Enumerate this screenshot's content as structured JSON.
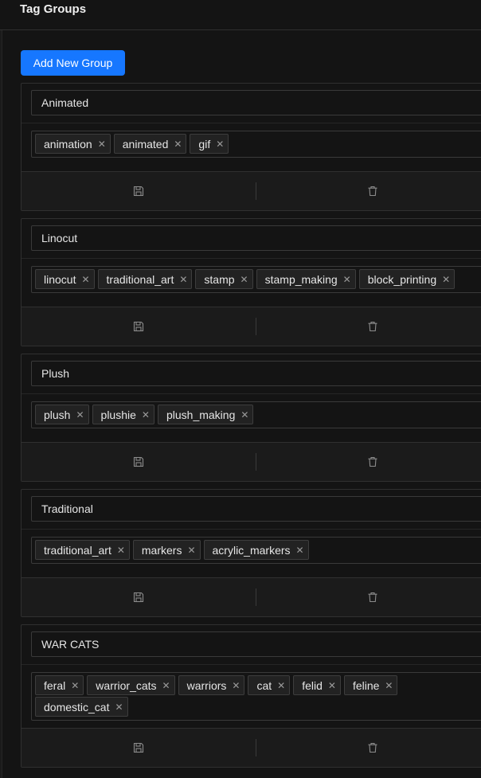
{
  "header": {
    "title": "Tag Groups"
  },
  "add_group": {
    "label": "Add New Group"
  },
  "icons": {
    "save": "save-icon",
    "delete": "delete-icon",
    "remove_tag": "close-icon"
  },
  "colors": {
    "primary": "#1677ff",
    "background": "#141414"
  },
  "groups": [
    {
      "name": "Animated",
      "tags": [
        "animation",
        "animated",
        "gif"
      ]
    },
    {
      "name": "Linocut",
      "tags": [
        "linocut",
        "traditional_art",
        "stamp",
        "stamp_making",
        "block_printing"
      ]
    },
    {
      "name": "Plush",
      "tags": [
        "plush",
        "plushie",
        "plush_making"
      ]
    },
    {
      "name": "Traditional",
      "tags": [
        "traditional_art",
        "markers",
        "acrylic_markers"
      ]
    },
    {
      "name": "WAR CATS",
      "tags": [
        "feral",
        "warrior_cats",
        "warriors",
        "cat",
        "felid",
        "feline",
        "domestic_cat"
      ]
    }
  ]
}
